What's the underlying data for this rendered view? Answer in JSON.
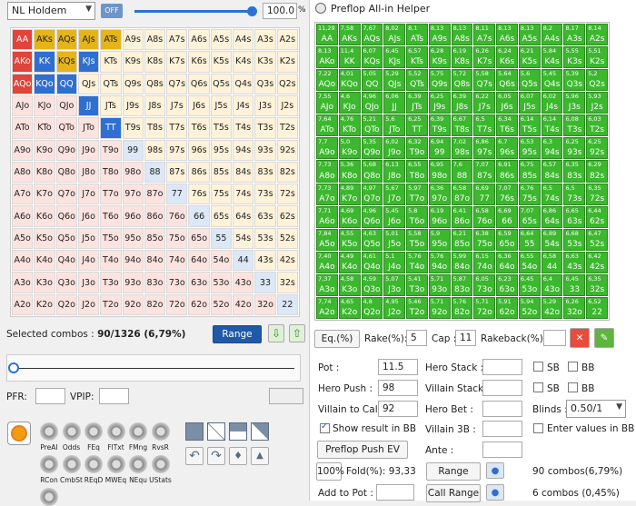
{
  "left": {
    "game_select": "NL Holdem",
    "off_label": "OFF",
    "range_pct": "100.0",
    "pct_sign": "%",
    "selected_label": "Selected combos :",
    "selected_value": "90/1326 (6,79%)",
    "range_button": "Range",
    "pfr_label": "PFR:",
    "vpip_label": "VPIP:",
    "tools": [
      "PreAI",
      "Odds",
      "FEq",
      "FlTxt",
      "FMng",
      "RvsR",
      "RCon",
      "CmbSt",
      "REqD",
      "MWEq",
      "NEqu",
      "UStats"
    ]
  },
  "grid1": {
    "hands": [
      [
        "AA",
        "AKs",
        "AQs",
        "AJs",
        "ATs",
        "A9s",
        "A8s",
        "A7s",
        "A6s",
        "A5s",
        "A4s",
        "A3s",
        "A2s"
      ],
      [
        "AKo",
        "KK",
        "KQs",
        "KJs",
        "KTs",
        "K9s",
        "K8s",
        "K7s",
        "K6s",
        "K5s",
        "K4s",
        "K3s",
        "K2s"
      ],
      [
        "AQo",
        "KQo",
        "QQ",
        "QJs",
        "QTs",
        "Q9s",
        "Q8s",
        "Q7s",
        "Q6s",
        "Q5s",
        "Q4s",
        "Q3s",
        "Q2s"
      ],
      [
        "AJo",
        "KJo",
        "QJo",
        "JJ",
        "JTs",
        "J9s",
        "J8s",
        "J7s",
        "J6s",
        "J5s",
        "J4s",
        "J3s",
        "J2s"
      ],
      [
        "ATo",
        "KTo",
        "QTo",
        "JTo",
        "TT",
        "T9s",
        "T8s",
        "T7s",
        "T6s",
        "T5s",
        "T4s",
        "T3s",
        "T2s"
      ],
      [
        "A9o",
        "K9o",
        "Q9o",
        "J9o",
        "T9o",
        "99",
        "98s",
        "97s",
        "96s",
        "95s",
        "94s",
        "93s",
        "92s"
      ],
      [
        "A8o",
        "K8o",
        "Q8o",
        "J8o",
        "T8o",
        "98o",
        "88",
        "87s",
        "86s",
        "85s",
        "84s",
        "83s",
        "82s"
      ],
      [
        "A7o",
        "K7o",
        "Q7o",
        "J7o",
        "T7o",
        "97o",
        "87o",
        "77",
        "76s",
        "75s",
        "74s",
        "73s",
        "72s"
      ],
      [
        "A6o",
        "K6o",
        "Q6o",
        "J6o",
        "T6o",
        "96o",
        "86o",
        "76o",
        "66",
        "65s",
        "64s",
        "63s",
        "62s"
      ],
      [
        "A5o",
        "K5o",
        "Q5o",
        "J5o",
        "T5o",
        "95o",
        "85o",
        "75o",
        "65o",
        "55",
        "54s",
        "53s",
        "52s"
      ],
      [
        "A4o",
        "K4o",
        "Q4o",
        "J4o",
        "T4o",
        "94o",
        "84o",
        "74o",
        "64o",
        "54o",
        "44",
        "43s",
        "42s"
      ],
      [
        "A3o",
        "K3o",
        "Q3o",
        "J3o",
        "T3o",
        "93o",
        "83o",
        "73o",
        "63o",
        "53o",
        "43o",
        "33",
        "32s"
      ],
      [
        "A2o",
        "K2o",
        "Q2o",
        "J2o",
        "T2o",
        "92o",
        "82o",
        "72o",
        "62o",
        "52o",
        "42o",
        "32o",
        "22"
      ]
    ],
    "selected": [
      "AA",
      "AKs",
      "AQs",
      "AJs",
      "ATs",
      "AKo",
      "KK",
      "KQs",
      "KJs",
      "AQo",
      "KQo",
      "QQ",
      "JJ",
      "TT"
    ],
    "colors": {
      "red": "#e0443a",
      "blue": "#2f6fd1",
      "gold": "#e4b41a",
      "pair": "#dce8f7",
      "suited": "#fff2d9",
      "offsuit": "#fde3df"
    }
  },
  "right": {
    "title": "Preflop All-in Helper",
    "ev_rows": [
      [
        "11,29",
        "7,58",
        "7,67",
        "8,02",
        "8,1",
        "8,13",
        "8,13",
        "8,11",
        "8,13",
        "8,13",
        "8,2",
        "8,17",
        "8,14"
      ],
      [
        "8,13",
        "11,4",
        "6,07",
        "6,45",
        "6,57",
        "6,28",
        "6,19",
        "6,26",
        "6,24",
        "6,21",
        "5,84",
        "5,55",
        "5,51"
      ],
      [
        "7,22",
        "4,01",
        "5,05",
        "5,29",
        "5,52",
        "5,75",
        "5,72",
        "5,58",
        "5,64",
        "5,6",
        "5,45",
        "5,39",
        "5,2"
      ],
      [
        "7,55",
        "4,6",
        "4,96",
        "6,06",
        "6,39",
        "6,25",
        "6,39",
        "6,22",
        "6,05",
        "6,07",
        "6,02",
        "5,96",
        "5,93"
      ],
      [
        "7,64",
        "4,76",
        "5,21",
        "5,6",
        "6,25",
        "6,39",
        "6,67",
        "6,5",
        "6,34",
        "6,14",
        "6,14",
        "6,08",
        "6,03"
      ],
      [
        "7,7",
        "5,0",
        "5,35",
        "6,02",
        "6,32",
        "6,94",
        "7,02",
        "6,86",
        "6,7",
        "6,53",
        "6,3",
        "6,25",
        "6,25"
      ],
      [
        "7,73",
        "5,36",
        "5,68",
        "6,13",
        "6,55",
        "6,95",
        "7,6",
        "7,07",
        "6,91",
        "6,75",
        "6,57",
        "6,35",
        "6,29"
      ],
      [
        "7,73",
        "4,89",
        "4,97",
        "5,67",
        "5,97",
        "6,36",
        "6,58",
        "6,69",
        "7,07",
        "6,76",
        "6,5",
        "6,5",
        "6,35"
      ],
      [
        "7,71",
        "4,69",
        "4,96",
        "5,45",
        "5,8",
        "6,19",
        "6,41",
        "6,58",
        "6,69",
        "7,07",
        "6,86",
        "6,65",
        "6,44"
      ],
      [
        "7,84",
        "4,55",
        "4,63",
        "5,01",
        "5,58",
        "5,9",
        "6,21",
        "6,38",
        "6,59",
        "6,64",
        "6,89",
        "6,68",
        "6,47"
      ],
      [
        "7,40",
        "4,49",
        "4,61",
        "5,1",
        "5,76",
        "5,76",
        "5,99",
        "6,15",
        "6,36",
        "6,55",
        "6,58",
        "6,63",
        "6,42"
      ],
      [
        "7,37",
        "4,58",
        "4,59",
        "5,07",
        "5,41",
        "5,71",
        "5,87",
        "6,05",
        "6,23",
        "6,45",
        "6,4",
        "6,45",
        "6,35"
      ],
      [
        "7,74",
        "4,65",
        "4,8",
        "4,95",
        "5,46",
        "5,71",
        "5,76",
        "5,71",
        "5,91",
        "5,94",
        "5,29",
        "6,26",
        "6,52"
      ]
    ],
    "eq_label": "Eq.(%)",
    "rake_label": "Rake(%):",
    "rake_value": "5",
    "cap_label": "Cap :",
    "cap_value": "11",
    "rakeback_label": "Rakeback(%):",
    "pot_label": "Pot :",
    "pot_value": "11.5",
    "hero_stack_label": "Hero Stack :",
    "hero_push_label": "Hero Push :",
    "hero_push_value": "98",
    "villain_stack_label": "Villain Stack :",
    "villain_call_label": "Villain to Call :",
    "villain_call_value": "92",
    "hero_bet_label": "Hero Bet :",
    "blinds_label": "Blinds :",
    "blinds_value": "0.50/1",
    "show_bb_label": "Show result in BB",
    "villain3b_label": "Villain 3B :",
    "enter_bb_label": "Enter values in BB",
    "push_ev_button": "Preflop Push EV",
    "ante_label": "Ante :",
    "pct100": "100%",
    "fold_label": "Fold(%): 93,33",
    "range_button": "Range",
    "combos1": "90 combos(6,79%)",
    "add_pot_label": "Add to Pot :",
    "call_range_button": "Call Range",
    "combos2": "6 combos (0,45%)",
    "sb": "SB",
    "bb": "BB"
  }
}
